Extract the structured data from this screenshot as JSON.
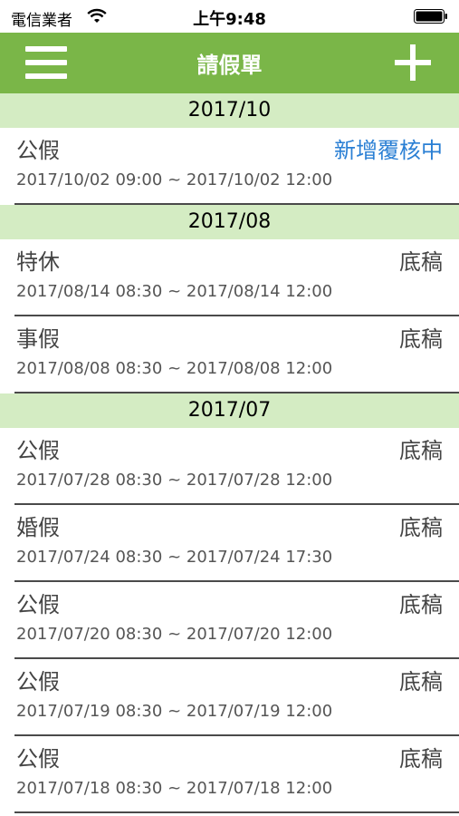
{
  "status_bar": {
    "carrier": "電信業者",
    "time": "上午9:48"
  },
  "nav": {
    "title": "請假單",
    "color": "#7ab648"
  },
  "sections": [
    {
      "header": "2017/10",
      "rows": [
        {
          "type": "公假",
          "status": "新增覆核中",
          "status_color": "blue",
          "range": "2017/10/02 09:00 ~ 2017/10/02 12:00"
        }
      ]
    },
    {
      "header": "2017/08",
      "rows": [
        {
          "type": "特休",
          "status": "底稿",
          "range": "2017/08/14 08:30 ~ 2017/08/14 12:00"
        },
        {
          "type": "事假",
          "status": "底稿",
          "range": "2017/08/08 08:30 ~ 2017/08/08 12:00"
        }
      ]
    },
    {
      "header": "2017/07",
      "rows": [
        {
          "type": "公假",
          "status": "底稿",
          "range": "2017/07/28 08:30 ~ 2017/07/28 12:00"
        },
        {
          "type": "婚假",
          "status": "底稿",
          "range": "2017/07/24 08:30 ~ 2017/07/24 17:30"
        },
        {
          "type": "公假",
          "status": "底稿",
          "range": "2017/07/20 08:30 ~ 2017/07/20 12:00"
        },
        {
          "type": "公假",
          "status": "底稿",
          "range": "2017/07/19 08:30 ~ 2017/07/19 12:00"
        },
        {
          "type": "公假",
          "status": "底稿",
          "range": "2017/07/18 08:30 ~ 2017/07/18 12:00"
        }
      ]
    }
  ]
}
